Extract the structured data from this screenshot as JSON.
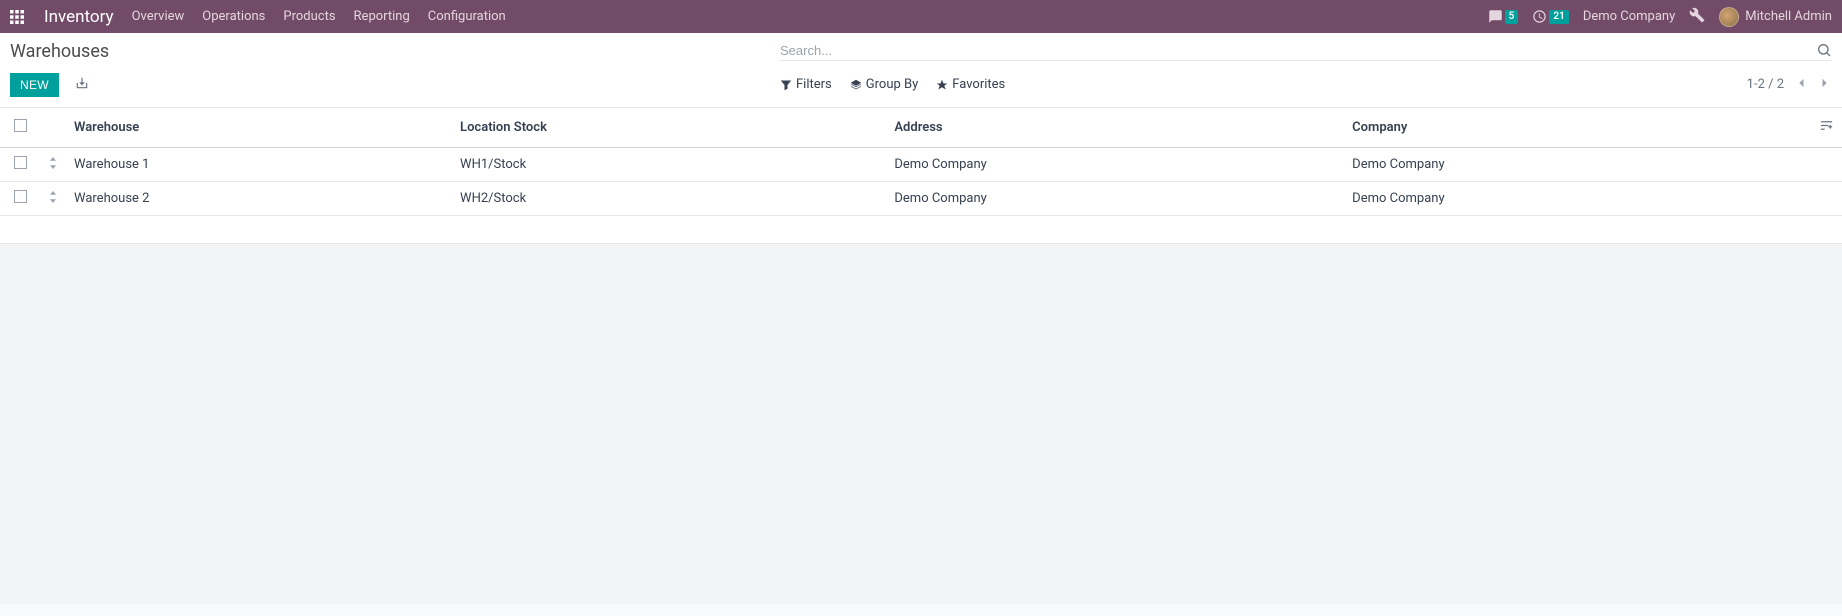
{
  "navbar": {
    "app_title": "Inventory",
    "menu": [
      "Overview",
      "Operations",
      "Products",
      "Reporting",
      "Configuration"
    ],
    "messages_count": "5",
    "activities_count": "21",
    "company": "Demo Company",
    "user": "Mitchell Admin"
  },
  "breadcrumb": "Warehouses",
  "search": {
    "placeholder": "Search..."
  },
  "buttons": {
    "new_label": "NEW"
  },
  "search_options": {
    "filters": "Filters",
    "group_by": "Group By",
    "favorites": "Favorites"
  },
  "pager": {
    "range": "1-2 / 2"
  },
  "table": {
    "headers": {
      "warehouse": "Warehouse",
      "location_stock": "Location Stock",
      "address": "Address",
      "company": "Company"
    },
    "rows": [
      {
        "warehouse": "Warehouse 1",
        "location_stock": "WH1/Stock",
        "address": "Demo Company",
        "company": "Demo Company"
      },
      {
        "warehouse": "Warehouse 2",
        "location_stock": "WH2/Stock",
        "address": "Demo Company",
        "company": "Demo Company"
      }
    ]
  }
}
